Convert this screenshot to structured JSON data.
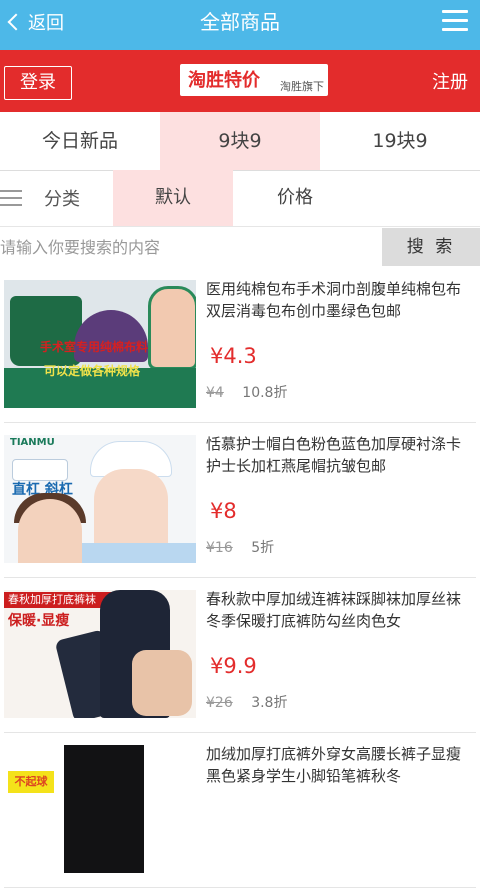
{
  "header": {
    "back_label": "返回",
    "title": "全部商品"
  },
  "brandbar": {
    "login_label": "登录",
    "logo_text": "淘胜特价",
    "logo_sub": "淘胜旗下",
    "register_label": "注册"
  },
  "tabs": [
    {
      "label": "今日新品"
    },
    {
      "label": "9块9"
    },
    {
      "label": "19块9"
    }
  ],
  "sort": {
    "category_label": "分类",
    "default_label": "默认",
    "price_label": "价格"
  },
  "search": {
    "placeholder": "请输入你要搜索的内容",
    "button_label": "搜 索"
  },
  "products": [
    {
      "name": "医用纯棉包布手术洞巾剖腹单纯棉包布双层消毒包布创巾墨绿色包邮",
      "price": "¥4.3",
      "original_price": "¥4",
      "discount": "10.8折",
      "thumb_text": [
        "手术室专用纯棉布料",
        "可以定做各种规格"
      ]
    },
    {
      "name": "恬慕护士帽白色粉色蓝色加厚硬衬涤卡护士长加杠燕尾帽抗皱包邮",
      "price": "¥8",
      "original_price": "¥16",
      "discount": "5折",
      "thumb_text": [
        "TIANMU",
        "直杠",
        "斜杠"
      ]
    },
    {
      "name": "春秋款中厚加绒连裤袜踩脚袜加厚丝袜冬季保暖打底裤防勾丝肉色女",
      "price": "¥9.9",
      "original_price": "¥26",
      "discount": "3.8折",
      "thumb_text": [
        "春秋加厚打底裤袜",
        "保暖·显瘦"
      ]
    },
    {
      "name": "加绒加厚打底裤外穿女高腰长裤子显瘦黑色紧身学生小脚铅笔裤秋冬",
      "price": "",
      "original_price": "",
      "discount": "",
      "thumb_text": [
        "不起球"
      ]
    }
  ],
  "colors": {
    "topbar": "#4db8e8",
    "brand_red": "#e32c2c",
    "active_tab": "#fde0e0"
  }
}
